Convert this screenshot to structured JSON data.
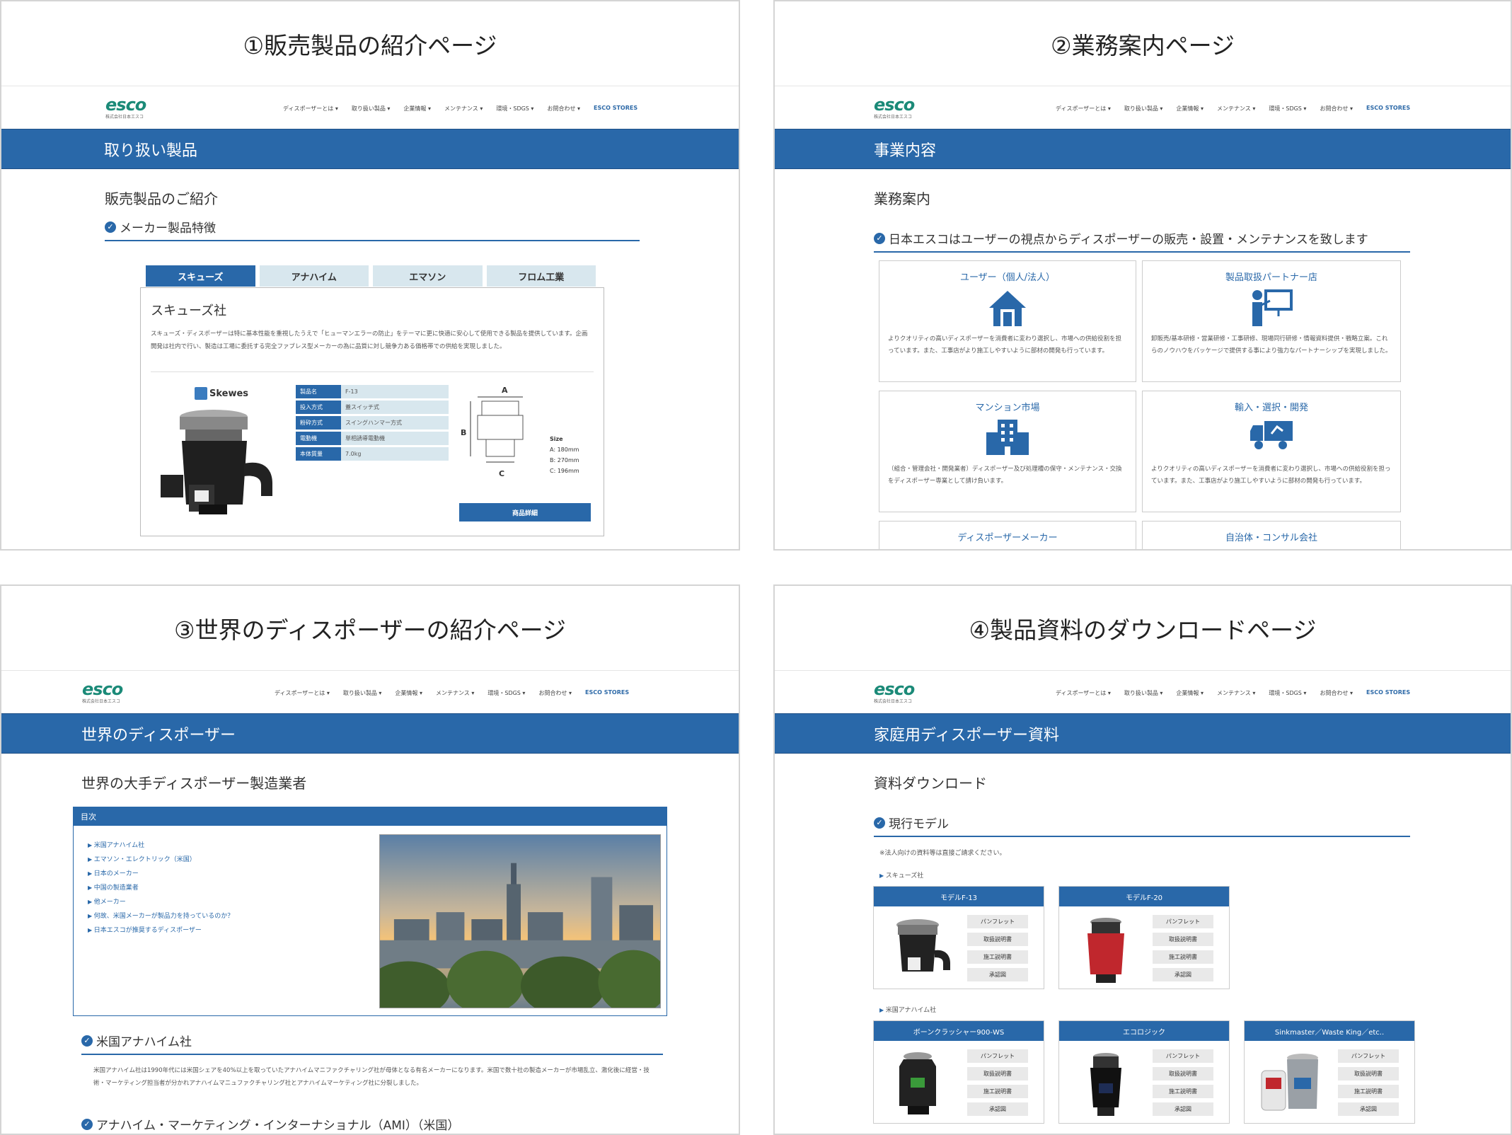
{
  "nav_items": [
    "ディスポーザーとは ▾",
    "取り扱い製品 ▾",
    "企業情報 ▾",
    "メンテナンス ▾",
    "環境・SDGS ▾",
    "お問合わせ ▾"
  ],
  "nav_store": "ESCO STORES",
  "logo": {
    "word": "esco",
    "sub": "株式会社日本エスコ"
  },
  "panel1": {
    "caption": "①販売製品の紹介ページ",
    "band": "取り扱い製品",
    "heading": "販売製品のご紹介",
    "section": "メーカー製品特徴",
    "tabs": [
      "スキューズ",
      "アナハイム",
      "エマソン",
      "フロム工業"
    ],
    "product_title": "スキューズ社",
    "description": "スキューズ・ディスポーザーは特に基本性能を重視したうえで「ヒューマンエラーの防止」をテーマに更に快適に安心して使用できる製品を提供しています。企画開発は社内で行い、製造は工場に委託する完全ファブレス型メーカーの為に品質に対し競争力ある価格帯での供給を実現しました。",
    "brand": "Skewes",
    "specs": [
      {
        "key": "製品名",
        "value": "F-13"
      },
      {
        "key": "投入方式",
        "value": "蓋スイッチ式"
      },
      {
        "key": "粉砕方式",
        "value": "スイングハンマー方式"
      },
      {
        "key": "電動機",
        "value": "単相誘導電動機"
      },
      {
        "key": "本体質量",
        "value": "7.0kg"
      }
    ],
    "dims": {
      "a": "A",
      "b": "B",
      "c": "C",
      "size": "Size",
      "a_val": "A: 180mm",
      "b_val": "B: 270mm",
      "c_val": "C: 196mm"
    },
    "detail_button": "商品詳細"
  },
  "panel2": {
    "caption": "②業務案内ページ",
    "band": "事業内容",
    "heading": "業務案内",
    "section": "日本エスコはユーザーの視点からディスポーザーの販売・設置・メンテナンスを致します",
    "cards": [
      {
        "title": "ユーザー（個人/法人）",
        "icon": "house-icon",
        "text": "よりクオリティの高いディスポーザーを消費者に変わり選択し、市場への供給役割を担っています。また、工事店がより施工しやすいように部材の開発も行っています。"
      },
      {
        "title": "製品取扱パートナー店",
        "icon": "presenter-icon",
        "text": "卸販売/基本研修・営業研修・工事研修、現場同行研修・情報資料提供・戦略立案。これらのノウハウをパッケージで提供する事により強力なパートナーシップを実現しました。"
      },
      {
        "title": "マンション市場",
        "icon": "building-icon",
        "text": "（組合・管理会社・開発業者）ディスポーザー及び処理槽の保守・メンテナンス・交換をディスポーザー専業として請け負います。"
      },
      {
        "title": "輸入・選択・開発",
        "icon": "truck-icon",
        "text": "よりクオリティの高いディスポーザーを消費者に変わり選択し、市場への供給役割を担っています。また、工事店がより施工しやすいように部材の開発も行っています。"
      },
      {
        "title": "ディスポーザーメーカー",
        "icon": "",
        "text": ""
      },
      {
        "title": "自治体・コンサル会社",
        "icon": "",
        "text": ""
      }
    ]
  },
  "panel3": {
    "caption": "③世界のディスポーザーの紹介ページ",
    "band": "世界のディスポーザー",
    "heading": "世界の大手ディスポーザー製造業者",
    "toc_title": "目次",
    "toc": [
      "米国アナハイム社",
      "エマソン・エレクトリック（米国）",
      "日本のメーカー",
      "中国の製造業者",
      "他メーカー",
      "何故、米国メーカーが製品力を持っているのか？",
      "日本エスコが推奨するディスポーザー"
    ],
    "section1": "米国アナハイム社",
    "para1": "米国アナハイム社は1990年代には米国シェアを40%以上を取っていたアナハイムマニファクチャリング社が母体となる有名メーカーになります。米国で数十社の製造メーカーが市場乱立、激化後に経営・技術・マーケティング担当者が分かれアナハイムマニュファクチャリング社とアナハイムマーケティング社に分裂しました。",
    "section2": "アナハイム・マーケティング・インターナショナル（AMI）（米国）"
  },
  "panel4": {
    "caption": "④製品資料のダウンロードページ",
    "band": "家庭用ディスポーザー資料",
    "heading": "資料ダウンロード",
    "section": "現行モデル",
    "note": "※法人向けの資料等は直接ご請求ください。",
    "group1": "スキューズ社",
    "group2": "米国アナハイム社",
    "doc_buttons": [
      "パンフレット",
      "取扱説明書",
      "施工説明書",
      "承認図"
    ],
    "models": [
      {
        "name": "モデルF-13",
        "color": "#222222"
      },
      {
        "name": "モデルF-20",
        "color": "#c0272d"
      },
      {
        "name": "ボーンクラッシャー900-WS",
        "color": "#222222"
      },
      {
        "name": "エコロジック",
        "color": "#1e2d55"
      },
      {
        "name": "Sinkmaster／Waste King／etc..",
        "color": "#9aa0a6"
      }
    ]
  },
  "colors": {
    "brand_blue": "#2968a9",
    "logo_green": "#1b8a78",
    "tab_light": "#d8e7ee"
  }
}
